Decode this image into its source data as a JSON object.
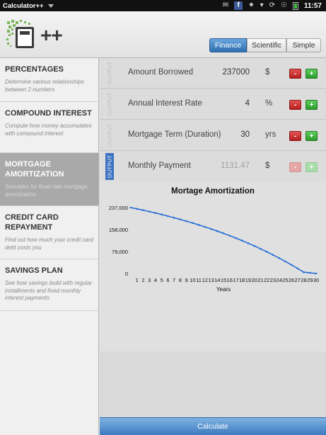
{
  "status_bar": {
    "app_name": "Calculator++",
    "clock": "11:57",
    "icons": [
      "mail-icon",
      "facebook-icon",
      "usb-icon",
      "signal-caret-icon",
      "rotation-lock-icon",
      "wifi-icon",
      "battery-icon"
    ],
    "facebook_glyph": "f"
  },
  "header": {
    "logo_text": "++",
    "modes": [
      "Finance",
      "Scientific",
      "Simple"
    ],
    "selected_mode": "Finance",
    "accent_color": "#2f6fb1"
  },
  "sidebar": {
    "items": [
      {
        "title": "PERCENTAGES",
        "description": "Determine various relationships between 2 numbers"
      },
      {
        "title": "COMPOUND INTEREST",
        "description": "Compute how money accumulates with compound interest"
      },
      {
        "title": "MORTGAGE AMORTIZATION",
        "description": "Simulator for fixed rate mortgage amortization",
        "active": true
      },
      {
        "title": "CREDIT CARD REPAYMENT",
        "description": "Find out how much your credit card debt costs you"
      },
      {
        "title": "SAVINGS PLAN",
        "description": "See how savings build with regular installments and fixed monthly interest payments"
      }
    ]
  },
  "form": {
    "rows": [
      {
        "tag": "OUTPUT",
        "label": "Amount Borrowed",
        "value": "237000",
        "unit": "$",
        "minus": "-",
        "plus": "+"
      },
      {
        "tag": "OUTPUT",
        "label": "Annual Interest Rate",
        "value": "4",
        "unit": "%",
        "minus": "-",
        "plus": "+"
      },
      {
        "tag": "OUTPUT",
        "label": "Mortgage Term (Duration)",
        "value": "30",
        "unit": "yrs",
        "minus": "-",
        "plus": "+"
      },
      {
        "tag": "OUTPUT",
        "label": "Monthly Payment",
        "value": "1131.47",
        "unit": "$",
        "minus": "-",
        "plus": "+",
        "is_output": true
      }
    ]
  },
  "chart_data": {
    "type": "line",
    "title": "Mortage Amortization",
    "xlabel": "Years",
    "ylabel": "",
    "x": [
      0,
      1,
      2,
      3,
      4,
      5,
      6,
      7,
      8,
      9,
      10,
      11,
      12,
      13,
      14,
      15,
      16,
      17,
      18,
      19,
      20,
      21,
      22,
      23,
      24,
      25,
      26,
      27,
      28,
      29,
      30
    ],
    "x_tick_labels": [
      "1",
      "2",
      "3",
      "4",
      "5",
      "6",
      "7",
      "8",
      "9",
      "10",
      "11",
      "12",
      "13",
      "14",
      "15",
      "16",
      "17",
      "18",
      "19",
      "20",
      "21",
      "22",
      "23",
      "24",
      "25",
      "26",
      "27",
      "28",
      "29",
      "30"
    ],
    "series": [
      {
        "values": [
          237000,
          232398,
          227608,
          222624,
          217437,
          212039,
          206422,
          200576,
          194492,
          188161,
          181571,
          174713,
          167577,
          160149,
          152420,
          144375,
          136003,
          127291,
          118224,
          108788,
          98968,
          88749,
          78113,
          67045,
          55526,
          43539,
          31064,
          18081,
          4570,
          2500,
          0
        ],
        "color": "#2a6fd6"
      }
    ],
    "y_ticks": [
      0,
      79000,
      158000,
      237000
    ],
    "y_tick_labels": [
      "0",
      "79,000",
      "158,000",
      "237,000"
    ],
    "ylim": [
      0,
      237000
    ],
    "grid": false,
    "legend": "none"
  },
  "footer": {
    "calculate_label": "Calculate"
  }
}
